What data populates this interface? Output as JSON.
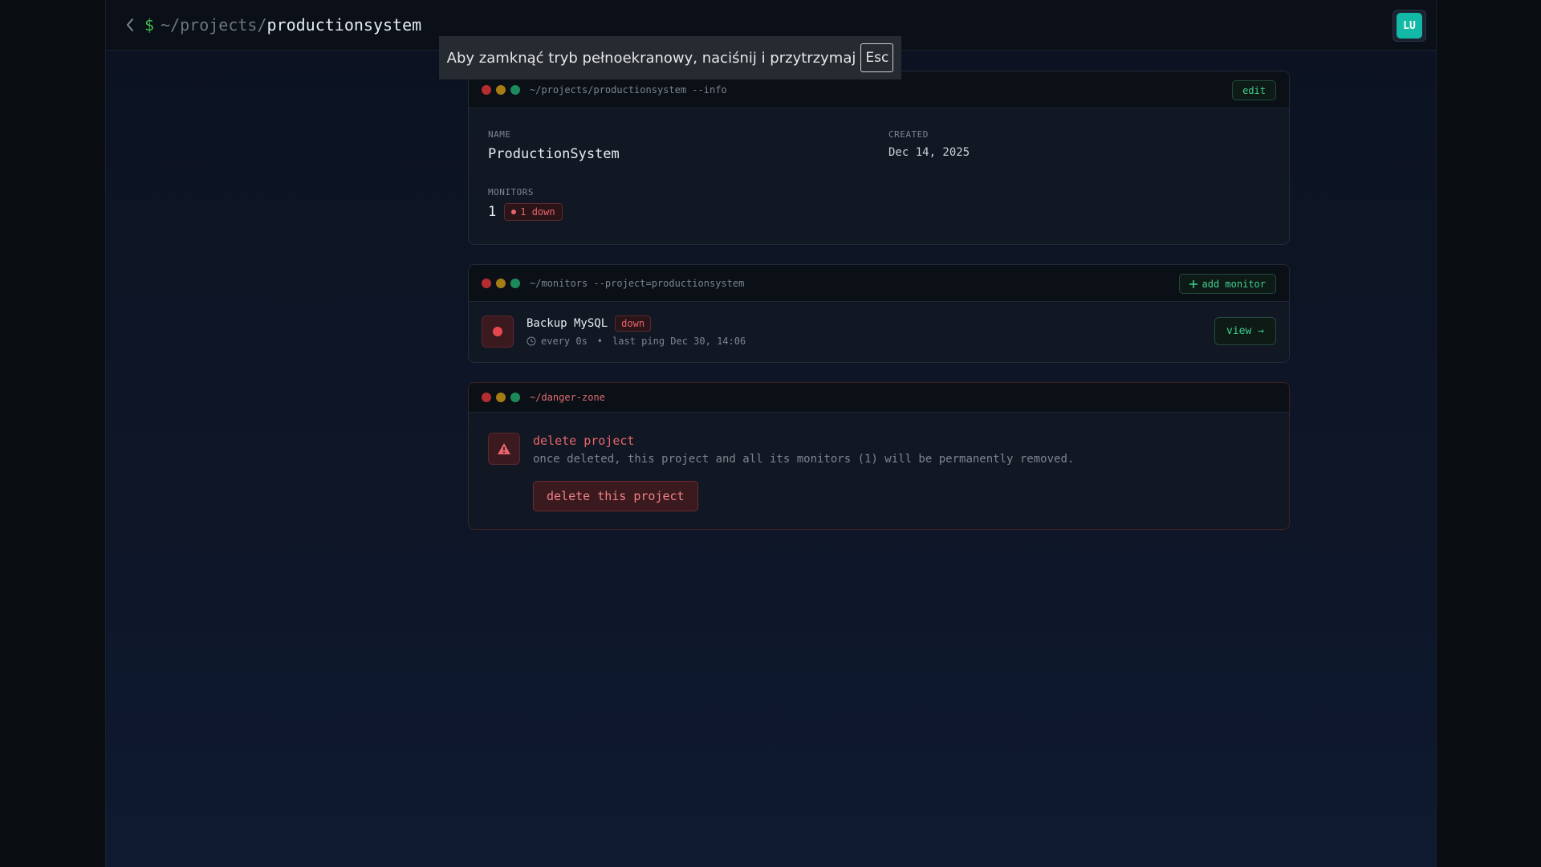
{
  "header": {
    "prompt_symbol": "$",
    "path_prefix": "~/projects/",
    "project_slug": "productionsystem",
    "avatar_initials": "LU"
  },
  "toast": {
    "message": "Aby zamknąć tryb pełnoekranowy, naciśnij i przytrzymaj",
    "key": "Esc"
  },
  "info_card": {
    "title": "~/projects/productionsystem --info",
    "edit_label": "edit",
    "name_label": "NAME",
    "name_value": "ProductionSystem",
    "created_label": "CREATED",
    "created_value": "Dec 14, 2025",
    "monitors_label": "MONITORS",
    "monitors_count": "1",
    "down_badge": "1 down"
  },
  "monitors_card": {
    "title": "~/monitors --project=productionsystem",
    "add_label": "add monitor",
    "items": [
      {
        "name": "Backup MySQL",
        "status": "down",
        "interval": "every 0s",
        "separator": "•",
        "last_ping": "last ping Dec 30, 14:06",
        "view_label": "view →"
      }
    ]
  },
  "danger_card": {
    "title": "~/danger-zone",
    "heading": "delete project",
    "description": "once deleted, this project and all its monitors (1) will be permanently removed.",
    "button_label": "delete this project"
  },
  "colors": {
    "accent_green": "#3fcf8e",
    "danger_red": "#e8646d",
    "avatar_teal": "#14b8a6",
    "background": "#0c1220"
  },
  "icons": {
    "back": "chevron-left-icon",
    "clock": "clock-icon",
    "warning": "warning-triangle-icon",
    "plus": "plus-icon"
  }
}
